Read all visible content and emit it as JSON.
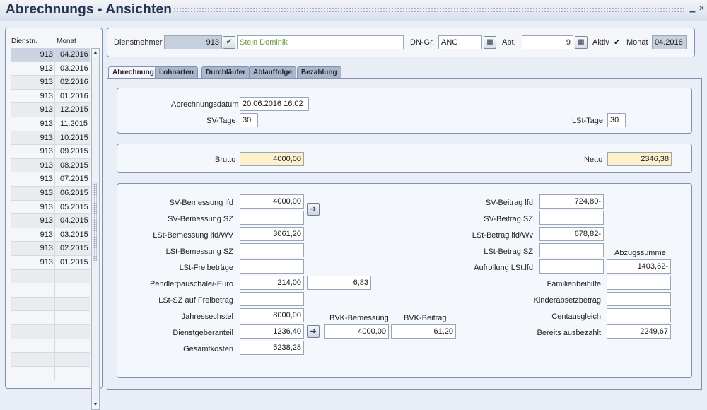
{
  "window": {
    "title": "Abrechnungs - Ansichten"
  },
  "list": {
    "col_dienstn": "Dienstn.",
    "col_monat": "Monat",
    "rows": [
      {
        "nr": "913",
        "monat": "04.2016"
      },
      {
        "nr": "913",
        "monat": "03.2016"
      },
      {
        "nr": "913",
        "monat": "02.2016"
      },
      {
        "nr": "913",
        "monat": "01.2016"
      },
      {
        "nr": "913",
        "monat": "12.2015"
      },
      {
        "nr": "913",
        "monat": "11.2015"
      },
      {
        "nr": "913",
        "monat": "10.2015"
      },
      {
        "nr": "913",
        "monat": "09.2015"
      },
      {
        "nr": "913",
        "monat": "08.2015"
      },
      {
        "nr": "913",
        "monat": "07.2015"
      },
      {
        "nr": "913",
        "monat": "06.2015"
      },
      {
        "nr": "913",
        "monat": "05.2015"
      },
      {
        "nr": "913",
        "monat": "04.2015"
      },
      {
        "nr": "913",
        "monat": "03.2015"
      },
      {
        "nr": "913",
        "monat": "02.2015"
      },
      {
        "nr": "913",
        "monat": "01.2015"
      }
    ]
  },
  "header": {
    "dienstnehmer_label": "Dienstnehmer",
    "dienstnehmer_nr": "913",
    "dienstnehmer_name": "Stein Dominik",
    "dngr_label": "DN-Gr.",
    "dngr_value": "ANG",
    "abt_label": "Abt.",
    "abt_value": "9",
    "aktiv_label": "Aktiv",
    "aktiv_check": "✔",
    "monat_label": "Monat",
    "monat_value": "04.2016"
  },
  "tabs": [
    "Abrechnung",
    "Lohnarten",
    "Durchläufer",
    "Ablauffolge",
    "Bezahlung"
  ],
  "abrechnung": {
    "datum_label": "Abrechnungsdatum",
    "datum_value": "20.06.2016 16:02",
    "svtage_label": "SV-Tage",
    "svtage_value": "30",
    "lsttage_label": "LSt-Tage",
    "lsttage_value": "30",
    "brutto_label": "Brutto",
    "brutto_value": "4000,00",
    "netto_label": "Netto",
    "netto_value": "2346,38"
  },
  "details": {
    "sv_bem_lfd_label": "SV-Bemessung lfd",
    "sv_bem_lfd_value": "4000,00",
    "sv_bem_sz_label": "SV-Bemessung SZ",
    "sv_bem_sz_value": "",
    "lst_bem_lfd_label": "LSt-Bemessung lfd/WV",
    "lst_bem_lfd_value": "3061,20",
    "lst_bem_sz_label": "LSt-Bemessung SZ",
    "lst_bem_sz_value": "",
    "lst_frei_label": "LSt-Freibeträge",
    "lst_frei_value": "",
    "pendler_label": "Pendlerpauschale/-Euro",
    "pendler_value": "214,00",
    "pendler_euro_value": "6,83",
    "lst_sz_frei_label": "LSt-SZ auf Freibetrag",
    "lst_sz_frei_value": "",
    "jahressechstel_label": "Jahressechstel",
    "jahressechstel_value": "8000,00",
    "dg_anteil_label": "Dienstgeberanteil",
    "dg_anteil_value": "1236,40",
    "gesamtkosten_label": "Gesamtkosten",
    "gesamtkosten_value": "5238,28",
    "bvk_bem_label": "BVK-Bemessung",
    "bvk_bem_value": "4000,00",
    "bvk_beitrag_label": "BVK-Beitrag",
    "bvk_beitrag_value": "61,20",
    "sv_beitrag_lfd_label": "SV-Beitrag lfd",
    "sv_beitrag_lfd_value": "724,80-",
    "sv_beitrag_sz_label": "SV-Beitrag SZ",
    "sv_beitrag_sz_value": "",
    "lst_betrag_lfd_label": "LSt-Betrag lfd/Wv",
    "lst_betrag_lfd_value": "678,82-",
    "lst_betrag_sz_label": "LSt-Betrag SZ",
    "lst_betrag_sz_value": "",
    "abzugssumme_label": "Abzugssumme",
    "aufrollung_label": "Aufrollung LSt.lfd",
    "aufrollung_value": "",
    "abzugssumme_value": "1403,62-",
    "familienbeihilfe_label": "Familienbeihilfe",
    "familienbeihilfe_value": "",
    "kinderabsetz_label": "Kinderabsetzbetrag",
    "kinderabsetz_value": "",
    "centausgleich_label": "Centausgleich",
    "centausgleich_value": "",
    "ausbezahlt_label": "Bereits ausbezahlt",
    "ausbezahlt_value": "2249,67"
  }
}
